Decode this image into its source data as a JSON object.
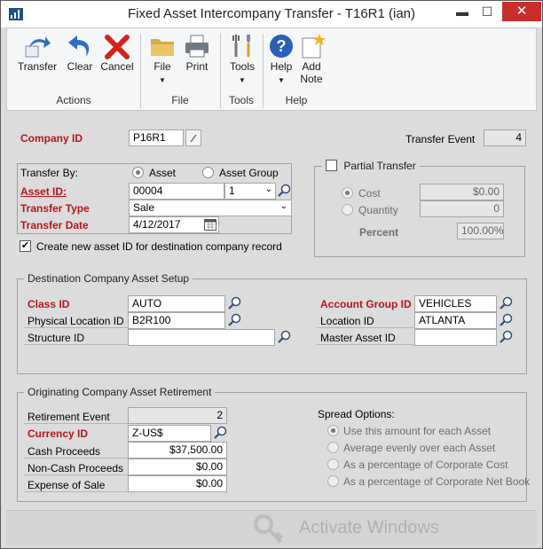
{
  "window": {
    "title": "Fixed Asset Intercompany Transfer  -  T16R1 (ian)",
    "min_glyph": "▬",
    "max_glyph": "☐",
    "close_glyph": "✕"
  },
  "ribbon": {
    "buttons": {
      "transfer": "Transfer",
      "clear": "Clear",
      "cancel": "Cancel",
      "file": "File",
      "print": "Print",
      "tools": "Tools",
      "help": "Help",
      "add_note_1": "Add",
      "add_note_2": "Note"
    },
    "groups": {
      "actions": "Actions",
      "file": "File",
      "tools": "Tools",
      "help": "Help"
    },
    "dropdown_glyph": "▼"
  },
  "header": {
    "company_id_label": "Company ID",
    "company_id_value": "P16R1",
    "transfer_event_label": "Transfer Event",
    "transfer_event_value": "4"
  },
  "transfer": {
    "transfer_by_label": "Transfer By:",
    "opt_asset": "Asset",
    "opt_asset_group": "Asset Group",
    "asset_id_label": "Asset ID:",
    "asset_id_value": "00004",
    "asset_suffix_value": "1",
    "transfer_type_label": "Transfer Type",
    "transfer_type_value": "Sale",
    "transfer_date_label": "Transfer Date",
    "transfer_date_value": "4/12/2017",
    "create_new_label": "Create new asset ID for destination company record",
    "check_glyph": "✔"
  },
  "partial": {
    "label": "Partial Transfer",
    "cost_label": "Cost",
    "cost_value": "$0.00",
    "quantity_label": "Quantity",
    "quantity_value": "0",
    "percent_label": "Percent",
    "percent_value": "100.00%"
  },
  "destination": {
    "title": "Destination Company Asset Setup",
    "class_id_label": "Class ID",
    "class_id_value": "AUTO",
    "physical_location_label": "Physical Location ID",
    "physical_location_value": "B2R100",
    "structure_id_label": "Structure ID",
    "structure_id_value": "",
    "account_group_label": "Account Group ID",
    "account_group_value": "VEHICLES",
    "location_id_label": "Location ID",
    "location_id_value": "ATLANTA",
    "master_asset_label": "Master Asset ID",
    "master_asset_value": ""
  },
  "retirement": {
    "title": "Originating Company Asset Retirement",
    "retirement_event_label": "Retirement Event",
    "retirement_event_value": "2",
    "currency_id_label": "Currency ID",
    "currency_id_value": "Z-US$",
    "cash_proceeds_label": "Cash Proceeds",
    "cash_proceeds_value": "$37,500.00",
    "non_cash_label": "Non-Cash Proceeds",
    "non_cash_value": "$0.00",
    "expense_label": "Expense of Sale",
    "expense_value": "$0.00"
  },
  "spread": {
    "title": "Spread Options:",
    "opt1": "Use this amount for each Asset",
    "opt2": "Average evenly over each Asset",
    "opt3": "As a percentage of Corporate Cost",
    "opt4": "As a percentage of Corporate Net Book"
  },
  "watermark": "Activate Windows",
  "colors": {
    "required": "#b5161c",
    "ribbon_bg": "#f5f6f8",
    "window_bg": "#dcdcdc",
    "close_red": "#c7302a"
  }
}
